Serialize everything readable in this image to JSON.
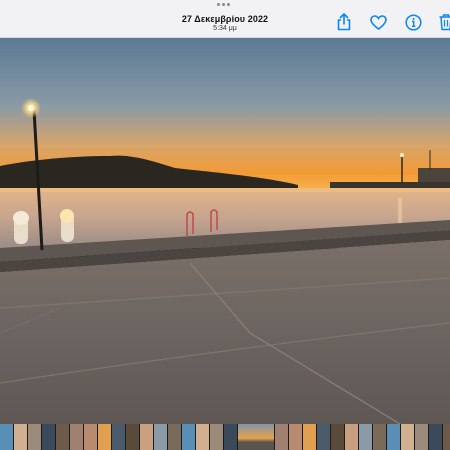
{
  "header": {
    "date": "27 Δεκεμβρίου 2022",
    "time": "5:34 μμ"
  },
  "toolbar": {
    "icons": [
      "share-icon",
      "heart-icon",
      "info-icon",
      "trash-icon"
    ],
    "accent": "#0a84ff"
  },
  "photo": {
    "description_colors": {
      "sky_top": "#5c7d97",
      "horizon": "#f0a03a",
      "sea": "#c9a489",
      "pavement": "#6b6560"
    }
  },
  "filmstrip": {
    "thumb_count": 33
  }
}
